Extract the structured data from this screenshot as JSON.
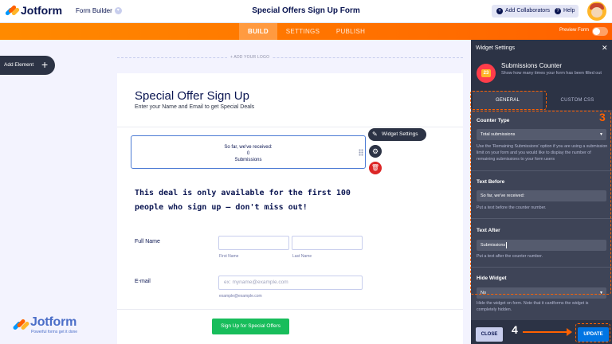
{
  "app": {
    "logo_text": "Jotform",
    "builder_label": "Form Builder"
  },
  "header": {
    "form_title": "Special Offers Sign Up Form",
    "add_collaborators": "Add Collaborators",
    "help": "Help"
  },
  "nav": {
    "tabs": [
      "BUILD",
      "SETTINGS",
      "PUBLISH"
    ],
    "active": "BUILD",
    "preview_label": "Preview Form"
  },
  "left": {
    "add_element": "Add Element"
  },
  "canvas": {
    "add_logo": "+ ADD YOUR LOGO",
    "title": "Special Offer Sign Up",
    "subtitle": "Enter your Name and Email to get Special Deals",
    "counter": {
      "before": "So far, we've received:",
      "count": "0",
      "after": "Submissions"
    },
    "highlight": "This deal is only available for the first 100 people who sign up — don't miss out!",
    "full_name_label": "Full Name",
    "first_name_sublabel": "First Name",
    "last_name_sublabel": "Last Name",
    "email_label": "E-mail",
    "email_placeholder": "ex: myname@example.com",
    "email_sublabel": "example@example.com",
    "submit": "Sign Up for Special Offers"
  },
  "floating": {
    "widget_settings": "Widget Settings"
  },
  "watermark": {
    "text": "Jotform",
    "tagline": "Powerful forms get it done"
  },
  "panel": {
    "title": "Widget Settings",
    "widget_name": "Submissions Counter",
    "widget_desc": "Show how many times your form has been filled out",
    "widget_icon_text": "23",
    "tabs": [
      "GENERAL",
      "CUSTOM CSS"
    ],
    "counter_type": {
      "label": "Counter Type",
      "value": "Total submissions",
      "help": "Use the 'Remaining Submissions' option if you are using a submission limit on your form and you would like to display the number of remaining submissions to your form users"
    },
    "text_before": {
      "label": "Text Before",
      "value": "So far, we've received:",
      "help": "Put a text before the counter number."
    },
    "text_after": {
      "label": "Text After",
      "value": "Submissions",
      "help": "Put a text after the counter number."
    },
    "hide_widget": {
      "label": "Hide Widget",
      "value": "No",
      "help": "Hide the widget on form. Note that it cardforms the widget is completely hidden."
    },
    "close": "CLOSE",
    "update": "UPDATE"
  },
  "annotations": {
    "step3": "3",
    "step4": "4",
    "color": "#ff6100"
  },
  "colors": {
    "nav_orange": "#ff6100",
    "submit_green": "#18bd5b",
    "update_blue": "#0075e3",
    "panel_dark": "#2c3345"
  }
}
